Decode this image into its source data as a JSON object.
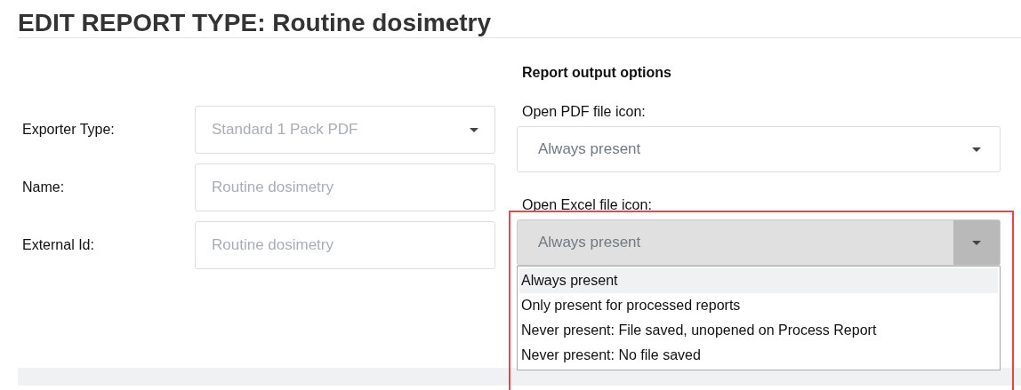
{
  "page_title": "EDIT REPORT TYPE: Routine dosimetry",
  "fields": [
    {
      "kind": "select",
      "label": "Exporter Type:",
      "value": "Standard 1 Pack PDF",
      "disabled": true
    },
    {
      "kind": "text",
      "label": "Name:",
      "value": "Routine dosimetry",
      "disabled": true
    },
    {
      "kind": "text",
      "label": "External Id:",
      "value": "Routine dosimetry",
      "disabled": true
    }
  ],
  "output_options": {
    "heading": "Report output options",
    "selects": [
      {
        "label": "Open PDF file icon:",
        "value": "Always present",
        "expanded": false
      },
      {
        "label": "Open Excel file icon:",
        "value": "Always present",
        "expanded": true,
        "options": [
          {
            "label": "Always present",
            "selected": true
          },
          {
            "label": "Only present for processed reports",
            "selected": false
          },
          {
            "label": "Never present: File saved, unopened on Process Report",
            "selected": false
          },
          {
            "label": "Never present: No file saved",
            "selected": false
          }
        ]
      }
    ]
  }
}
